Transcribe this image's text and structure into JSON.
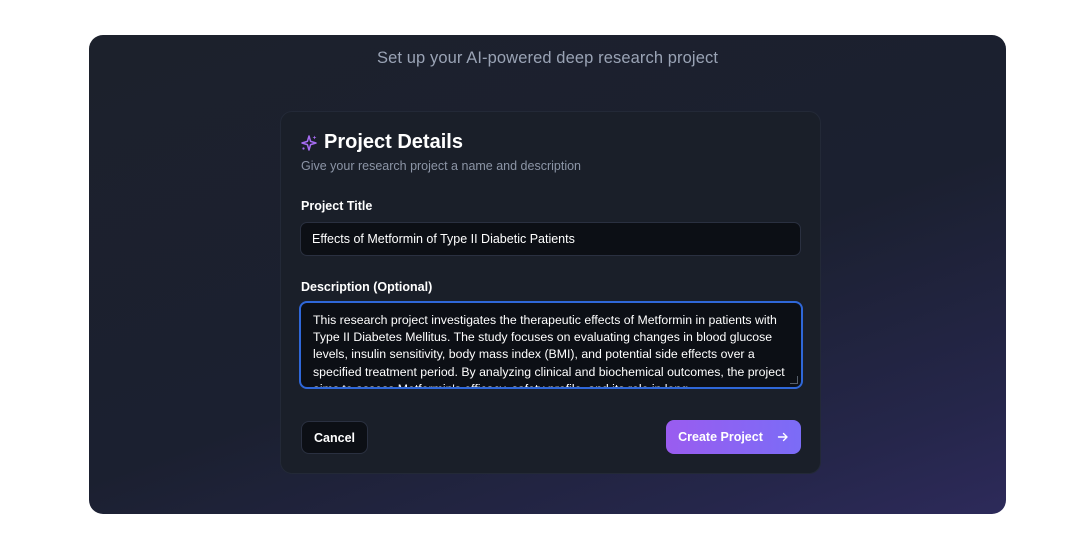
{
  "header": {
    "subtitle": "Set up your AI-powered deep research project"
  },
  "card": {
    "title_icon": "sparkles-icon",
    "title": "Project Details",
    "description": "Give your research project a name and description",
    "title_field": {
      "label": "Project Title",
      "value": "Effects of Metformin of Type II Diabetic Patients"
    },
    "description_field": {
      "label": "Description (Optional)",
      "value": "This research project investigates the therapeutic effects of Metformin in patients with Type II Diabetes Mellitus. The study focuses on evaluating changes in blood glucose levels, insulin sensitivity, body mass index (BMI), and potential side effects over a specified treatment period. By analyzing clinical and biochemical outcomes, the project aims to assess Metformin's efficacy, safety profile, and its role in long-"
    },
    "actions": {
      "cancel_label": "Cancel",
      "create_label": "Create Project",
      "create_icon": "arrow-right-icon"
    }
  },
  "colors": {
    "accent_start": "#9a5cf0",
    "accent_end": "#7b6cf6",
    "focus_border": "#2f67d8",
    "sparkle_icon": "#a66cf2"
  }
}
